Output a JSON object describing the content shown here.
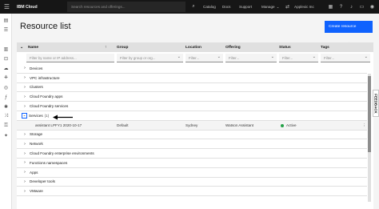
{
  "topbar": {
    "brand": "IBM Cloud",
    "search_placeholder": "Search resources and offerings...",
    "nav": [
      "Catalog",
      "Docs",
      "Support",
      "Manage"
    ],
    "manage_caret": "⌄",
    "account": "Applexic Inc"
  },
  "page": {
    "title": "Resource list",
    "create_button": "Create resource"
  },
  "table": {
    "columns": [
      "Name",
      "Group",
      "Location",
      "Offering",
      "Status",
      "Tags"
    ],
    "filters": {
      "name": "Filter by name or IP address...",
      "group": "Filter by group or org...",
      "location": "Filter...",
      "offering": "Filter...",
      "status": "Filter...",
      "tags": "Filter..."
    },
    "groups": [
      {
        "label": "Devices",
        "count": ""
      },
      {
        "label": "VPC infrastructure",
        "count": ""
      },
      {
        "label": "Clusters",
        "count": ""
      },
      {
        "label": "Cloud Foundry apps",
        "count": ""
      },
      {
        "label": "Cloud Foundry services",
        "count": ""
      },
      {
        "label": "Services",
        "count": "(1)"
      },
      {
        "label": "Storage",
        "count": ""
      },
      {
        "label": "Network",
        "count": ""
      },
      {
        "label": "Cloud Foundry enterprise environments",
        "count": ""
      },
      {
        "label": "Functions namespaces",
        "count": ""
      },
      {
        "label": "Apps",
        "count": ""
      },
      {
        "label": "Developer tools",
        "count": ""
      },
      {
        "label": "VMware",
        "count": ""
      }
    ],
    "service_row": {
      "name": "assistant LPFY1 2020-10-17",
      "group": "Default",
      "location": "Sydney",
      "offering": "Watson Assistant",
      "status": "Active",
      "menu": "⋮"
    }
  },
  "feedback_label": "FEEDBACK",
  "colors": {
    "primary": "#0f62fe",
    "active": "#24a148",
    "shell": "#161616"
  }
}
